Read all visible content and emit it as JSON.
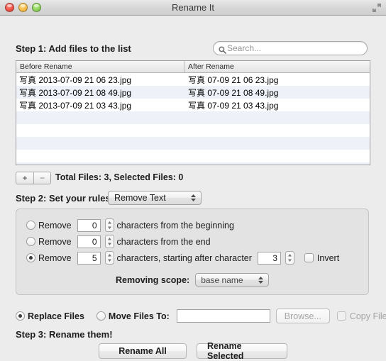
{
  "window": {
    "title": "Rename It",
    "traffic_lights": [
      "close-button",
      "minimize-button",
      "zoom-button"
    ],
    "fullscreen_icon": "fullscreen-arrows-icon"
  },
  "step1": {
    "label": "Step 1: Add files to the list",
    "search": {
      "placeholder": "Search...",
      "value": "",
      "icon": "search-icon"
    }
  },
  "file_list": {
    "columns": [
      "Before Rename",
      "After Rename"
    ],
    "rows": [
      {
        "before": "写真 2013-07-09 21 06 23.jpg",
        "after": "写真 07-09 21 06 23.jpg"
      },
      {
        "before": "写真 2013-07-09 21 08 49.jpg",
        "after": "写真 07-09 21 08 49.jpg"
      },
      {
        "before": "写真 2013-07-09 21 03 43.jpg",
        "after": "写真 07-09 21 03 43.jpg"
      }
    ],
    "empty_row_count": 5
  },
  "list_toolbar": {
    "add_label": "+",
    "remove_label": "−",
    "counts": "Total Files: 3,  Selected Files: 0"
  },
  "step2": {
    "label": "Step 2: Set your rules:",
    "rule_select": {
      "value": "Remove Text",
      "options": [
        "Remove Text"
      ],
      "icon": "up-down-arrows-icon"
    },
    "rules": {
      "row1": {
        "radio_checked": false,
        "prefix": "Remove",
        "value": "0",
        "suffix": "characters from the beginning"
      },
      "row2": {
        "radio_checked": false,
        "prefix": "Remove",
        "value": "0",
        "suffix": "characters from the end"
      },
      "row3": {
        "radio_checked": true,
        "prefix": "Remove",
        "value": "5",
        "middle": "characters, starting after character",
        "value2": "3",
        "invert_label": "Invert",
        "invert_checked": false
      },
      "scope": {
        "label": "Removing scope:",
        "value": "base name",
        "options": [
          "base name"
        ],
        "icon": "up-down-arrows-icon"
      }
    }
  },
  "destination": {
    "replace_label": "Replace Files",
    "replace_checked": true,
    "move_label": "Move Files To:",
    "move_checked": false,
    "move_path_value": "",
    "browse_label": "Browse...",
    "browse_disabled": true,
    "copy_files_label": "Copy Files",
    "copy_files_checked": false,
    "copy_files_disabled": true
  },
  "step3": {
    "label": "Step 3: Rename them!",
    "rename_all_label": "Rename All",
    "rename_selected_label": "Rename Selected"
  },
  "colors": {
    "window_bg": "#ececec",
    "group_bg": "#e3e3e3",
    "row_stripe": "#eef2f8",
    "text": "#1c1c1c",
    "disabled_text": "#a6a6a6"
  }
}
